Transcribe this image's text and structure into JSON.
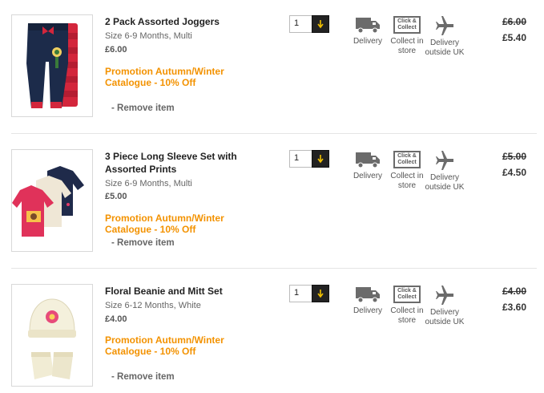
{
  "items": [
    {
      "title": "2 Pack Assorted Joggers",
      "size": "Size 6-9 Months, Multi",
      "price": "£6.00",
      "promo": "Promotion Autumn/Winter Catalogue - 10% Off",
      "remove_label": "- Remove item",
      "quantity": "1",
      "delivery_label": "Delivery",
      "collect_label": "Collect in store",
      "outside_label": "Delivery outside UK",
      "collect_badge": "Click & Collect",
      "old_price": "£6.00",
      "new_price": "£5.40"
    },
    {
      "title": "3 Piece Long Sleeve Set with Assorted Prints",
      "size": "Size 6-9 Months, Multi",
      "price": "£5.00",
      "promo": "Promotion Autumn/Winter Catalogue - 10% Off",
      "remove_label": "- Remove item",
      "quantity": "1",
      "delivery_label": "Delivery",
      "collect_label": "Collect in store",
      "outside_label": "Delivery outside UK",
      "collect_badge": "Click & Collect",
      "old_price": "£5.00",
      "new_price": "£4.50"
    },
    {
      "title": "Floral Beanie and Mitt Set",
      "size": "Size 6-12 Months, White",
      "price": "£4.00",
      "promo": "Promotion Autumn/Winter Catalogue - 10% Off",
      "remove_label": "- Remove item",
      "quantity": "1",
      "delivery_label": "Delivery",
      "collect_label": "Collect in store",
      "outside_label": "Delivery outside UK",
      "collect_badge": "Click & Collect",
      "old_price": "£4.00",
      "new_price": "£3.60"
    }
  ],
  "colors": {
    "promo": "#f39200",
    "qty_button": "#222222",
    "arrow": "#f0c000",
    "icon": "#6b6b6b"
  }
}
